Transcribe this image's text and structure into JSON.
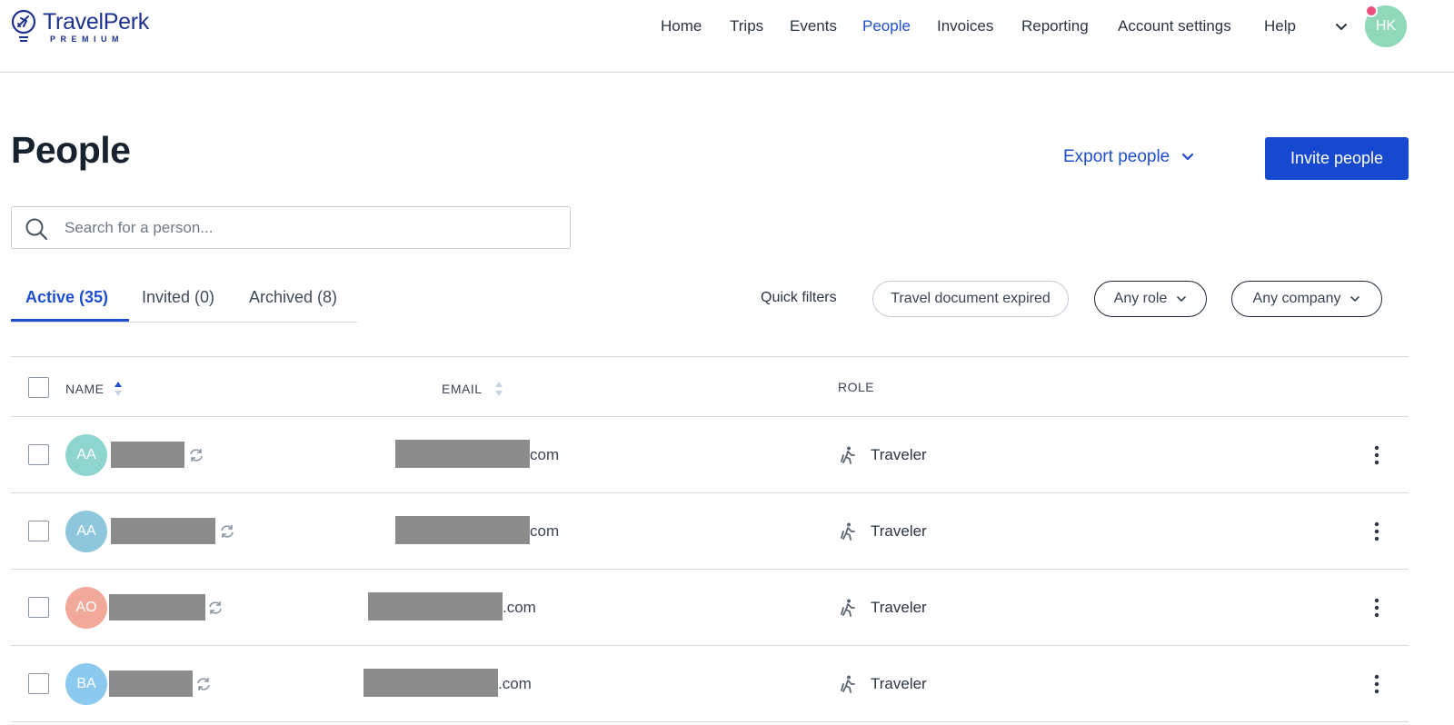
{
  "brand": {
    "name": "TravelPerk",
    "tier": "PREMIUM"
  },
  "nav": {
    "items": [
      {
        "label": "Home",
        "active": false
      },
      {
        "label": "Trips",
        "active": false
      },
      {
        "label": "Events",
        "active": false
      },
      {
        "label": "People",
        "active": true
      },
      {
        "label": "Invoices",
        "active": false
      },
      {
        "label": "Reporting",
        "active": false
      },
      {
        "label": "Account settings",
        "active": false
      },
      {
        "label": "Help",
        "active": false
      }
    ],
    "user_initials": "HK"
  },
  "page": {
    "title": "People",
    "export_label": "Export people",
    "invite_label": "Invite people"
  },
  "search": {
    "placeholder": "Search for a person..."
  },
  "tabs": [
    {
      "label": "Active (35)",
      "active": true
    },
    {
      "label": "Invited (0)",
      "active": false
    },
    {
      "label": "Archived (8)",
      "active": false
    }
  ],
  "filters": {
    "label": "Quick filters",
    "chips": [
      {
        "label": "Travel document expired"
      },
      {
        "label": "Any role"
      },
      {
        "label": "Any company"
      }
    ]
  },
  "table": {
    "columns": {
      "name": "NAME",
      "email": "EMAIL",
      "role": "ROLE"
    },
    "rows": [
      {
        "initials": "AA",
        "avatar_color": "#8fd5cf",
        "email_suffix": "com",
        "role": "Traveler"
      },
      {
        "initials": "AA",
        "avatar_color": "#8ec7dc",
        "email_suffix": "com",
        "role": "Traveler"
      },
      {
        "initials": "AO",
        "avatar_color": "#f1a99a",
        "email_suffix": ".com",
        "role": "Traveler"
      },
      {
        "initials": "BA",
        "avatar_color": "#8cc9ef",
        "email_suffix": ".com",
        "role": "Traveler"
      }
    ]
  },
  "colors": {
    "accent": "#1f4fce",
    "primary_button": "#1748d0",
    "notification": "#ec4f7a",
    "user_avatar": "#8fd8b8"
  }
}
